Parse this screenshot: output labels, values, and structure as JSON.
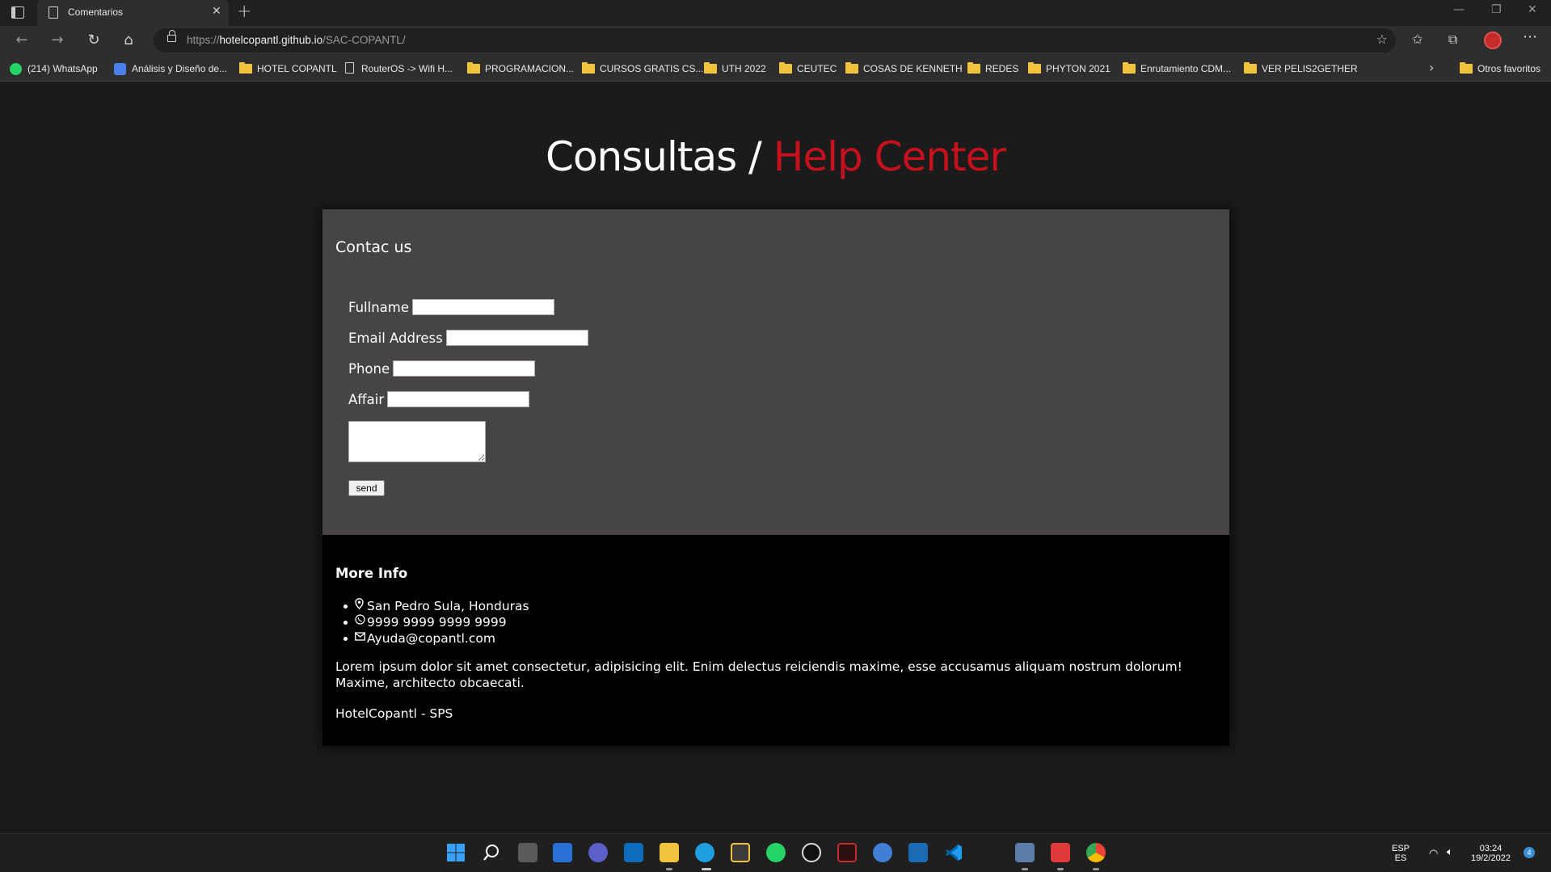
{
  "browser": {
    "tab_title": "Comentarios",
    "url_scheme": "https://",
    "url_host": "hotelcopantl.github.io",
    "url_path": "/SAC-COPANTL/",
    "bookmarks": [
      {
        "label": "(214) WhatsApp",
        "icon": "whatsapp-icon"
      },
      {
        "label": "Análisis y Diseño de...",
        "icon": "video-icon"
      },
      {
        "label": "HOTEL COPANTL",
        "icon": "folder-icon"
      },
      {
        "label": "RouterOS -> Wifi H...",
        "icon": "page-icon"
      },
      {
        "label": "PROGRAMACION...",
        "icon": "folder-icon"
      },
      {
        "label": "CURSOS GRATIS CS...",
        "icon": "folder-icon"
      },
      {
        "label": "UTH 2022",
        "icon": "folder-icon"
      },
      {
        "label": "CEUTEC",
        "icon": "folder-icon"
      },
      {
        "label": "COSAS DE KENNETH",
        "icon": "folder-icon"
      },
      {
        "label": "REDES",
        "icon": "folder-icon"
      },
      {
        "label": "PHYTON 2021",
        "icon": "folder-icon"
      },
      {
        "label": "Enrutamiento CDM...",
        "icon": "folder-icon"
      },
      {
        "label": "VER PELIS2GETHER",
        "icon": "folder-icon"
      }
    ],
    "other_favorites": "Otros favoritos"
  },
  "page": {
    "title_main": "Consultas /",
    "title_accent": "Help Center",
    "accent_color": "#c4111d",
    "form": {
      "heading": "Contac us",
      "fields": [
        {
          "label": "Fullname",
          "value": ""
        },
        {
          "label": "Email Address",
          "value": ""
        },
        {
          "label": "Phone",
          "value": ""
        },
        {
          "label": "Affair",
          "value": ""
        }
      ],
      "message_value": "",
      "send_label": "send"
    },
    "info": {
      "heading": "More Info",
      "items": [
        {
          "icon": "location-pin-icon",
          "text": "San Pedro Sula, Honduras"
        },
        {
          "icon": "whatsapp-icon",
          "text": "9999 9999 9999 9999"
        },
        {
          "icon": "envelope-icon",
          "text": "Ayuda@copantl.com"
        }
      ],
      "description": "Lorem ipsum dolor sit amet consectetur, adipisicing elit. Enim delectus reiciendis maxime, esse accusamus aliquam nostrum dolorum! Maxime, architecto obcaecati.",
      "footer": "HotelCopantl - SPS"
    }
  },
  "taskbar": {
    "lang_top": "ESP",
    "lang_bottom": "ES",
    "time": "03:24",
    "date": "19/2/2022",
    "notification_count": "4"
  }
}
